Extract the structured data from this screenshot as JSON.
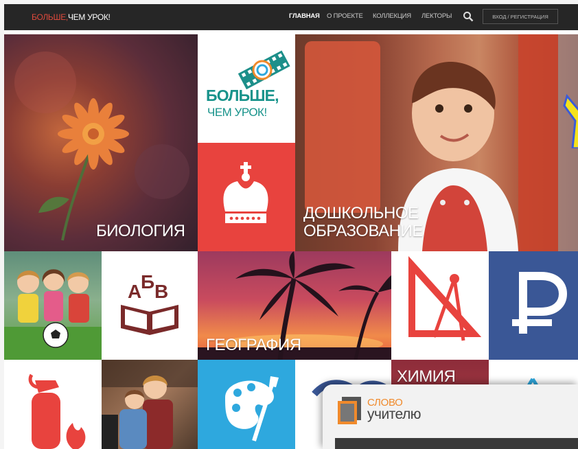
{
  "header": {
    "logo_part1": "БОЛЬШЕ,",
    "logo_part2": "ЧЕМ УРОК!",
    "nav": [
      "ГЛАВНАЯ",
      "О ПРОЕКТЕ",
      "КОЛЛЕКЦИЯ",
      "ЛЕКТОРЫ"
    ],
    "login": "ВХОД / РЕГИСТРАЦИЯ"
  },
  "tiles": {
    "biology": "БИОЛОГИЯ",
    "brand_line1": "БОЛЬШЕ,",
    "brand_line2": "ЧЕМ УРОК!",
    "preschool_line1": "ДОШКОЛЬНОЕ",
    "preschool_line2": "ОБРАЗОВАНИЕ",
    "abc_letters": "АБВ",
    "geography": "ГЕОГРАФИЯ",
    "chemistry": "ХИМИЯ"
  },
  "popup": {
    "logo_line1": "СЛОВО",
    "logo_line2": "учителю"
  },
  "colors": {
    "accent_red": "#e8433e",
    "brand_teal": "#18938b",
    "ruble_blue": "#3a5796",
    "paint_blue": "#2ea8de",
    "topbar": "#262626"
  }
}
